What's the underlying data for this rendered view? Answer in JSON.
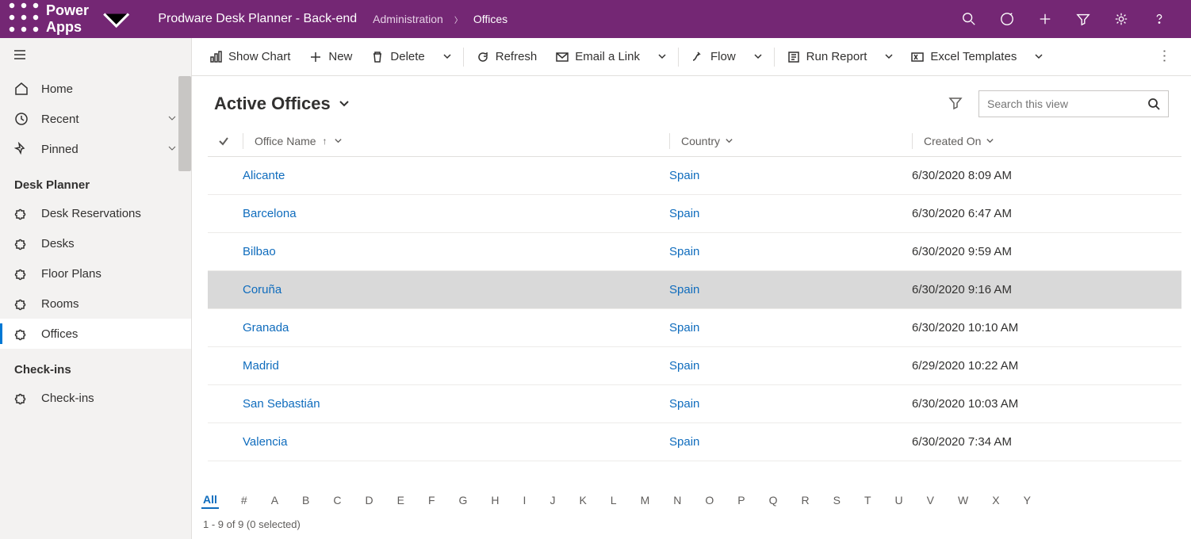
{
  "header": {
    "app_title": "Power Apps",
    "env_name": "Prodware Desk Planner - Back-end",
    "breadcrumb_parent": "Administration",
    "breadcrumb_current": "Offices"
  },
  "sidebar": {
    "nav": {
      "home": "Home",
      "recent": "Recent",
      "pinned": "Pinned"
    },
    "section1_label": "Desk Planner",
    "section1_items": [
      "Desk Reservations",
      "Desks",
      "Floor Plans",
      "Rooms",
      "Offices"
    ],
    "section2_label": "Check-ins",
    "section2_items": [
      "Check-ins"
    ],
    "active_item": "Offices"
  },
  "commandbar": {
    "show_chart": "Show Chart",
    "new": "New",
    "delete": "Delete",
    "refresh": "Refresh",
    "email_link": "Email a Link",
    "flow": "Flow",
    "run_report": "Run Report",
    "excel_templates": "Excel Templates"
  },
  "view": {
    "title": "Active Offices",
    "search_placeholder": "Search this view"
  },
  "grid": {
    "columns": {
      "name": "Office Name",
      "country": "Country",
      "created": "Created On"
    },
    "rows": [
      {
        "name": "Alicante",
        "country": "Spain",
        "created": "6/30/2020 8:09 AM",
        "hover": false
      },
      {
        "name": "Barcelona",
        "country": "Spain",
        "created": "6/30/2020 6:47 AM",
        "hover": false
      },
      {
        "name": "Bilbao",
        "country": "Spain",
        "created": "6/30/2020 9:59 AM",
        "hover": false
      },
      {
        "name": "Coruña",
        "country": "Spain",
        "created": "6/30/2020 9:16 AM",
        "hover": true
      },
      {
        "name": "Granada",
        "country": "Spain",
        "created": "6/30/2020 10:10 AM",
        "hover": false
      },
      {
        "name": "Madrid",
        "country": "Spain",
        "created": "6/29/2020 10:22 AM",
        "hover": false
      },
      {
        "name": "San Sebastián",
        "country": "Spain",
        "created": "6/30/2020 10:03 AM",
        "hover": false
      },
      {
        "name": "Valencia",
        "country": "Spain",
        "created": "6/30/2020 7:34 AM",
        "hover": false
      }
    ]
  },
  "alpha": {
    "items": [
      "All",
      "#",
      "A",
      "B",
      "C",
      "D",
      "E",
      "F",
      "G",
      "H",
      "I",
      "J",
      "K",
      "L",
      "M",
      "N",
      "O",
      "P",
      "Q",
      "R",
      "S",
      "T",
      "U",
      "V",
      "W",
      "X",
      "Y"
    ],
    "active": "All"
  },
  "status": "1 - 9 of 9 (0 selected)"
}
